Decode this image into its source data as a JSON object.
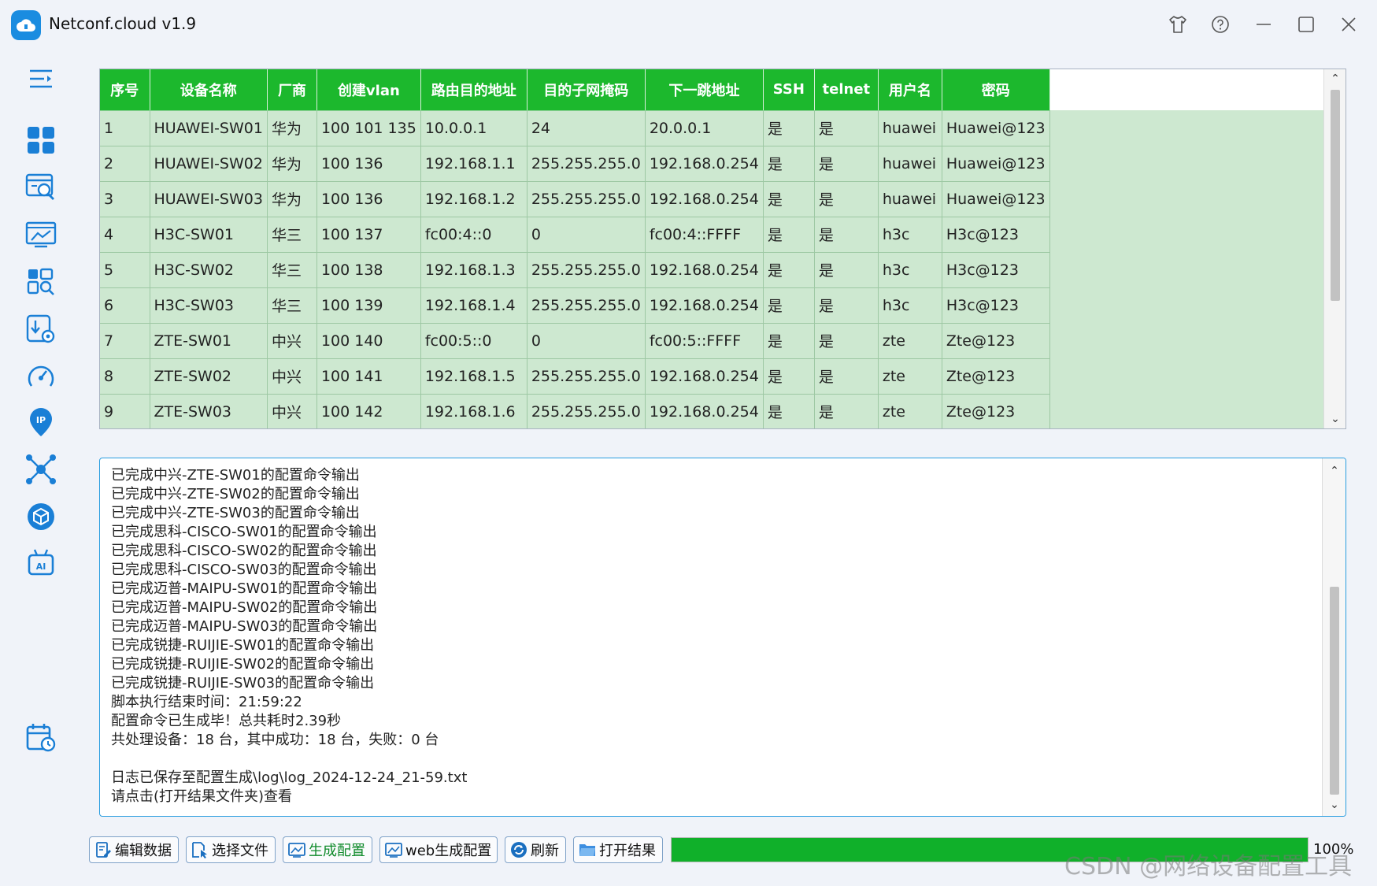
{
  "app": {
    "title": "Netconf.cloud v1.9"
  },
  "sidebar": {
    "items": [
      {
        "icon": "menu-toggle-icon"
      },
      {
        "icon": "dashboard-grid-icon"
      },
      {
        "icon": "search-screen-icon"
      },
      {
        "icon": "monitor-config-icon"
      },
      {
        "icon": "find-device-icon"
      },
      {
        "icon": "download-settings-icon"
      },
      {
        "icon": "speed-gauge-icon"
      },
      {
        "icon": "ip-location-icon"
      },
      {
        "icon": "network-topology-icon"
      },
      {
        "icon": "cube-icon"
      },
      {
        "icon": "ai-robot-icon"
      },
      {
        "icon": "calendar-clock-icon"
      }
    ]
  },
  "table": {
    "headers": [
      "序号",
      "设备名称",
      "厂商",
      "创建vlan",
      "路由目的地址",
      "目的子网掩码",
      "下一跳地址",
      "SSH",
      "telnet",
      "用户名",
      "密码"
    ],
    "rows": [
      [
        "1",
        "HUAWEI-SW01",
        "华为",
        "100 101 135",
        "10.0.0.1",
        "24",
        "20.0.0.1",
        "是",
        "是",
        "huawei",
        "Huawei@123"
      ],
      [
        "2",
        "HUAWEI-SW02",
        "华为",
        "100 136",
        "192.168.1.1",
        "255.255.255.0",
        "192.168.0.254",
        "是",
        "是",
        "huawei",
        "Huawei@123"
      ],
      [
        "3",
        "HUAWEI-SW03",
        "华为",
        "100 136",
        "192.168.1.2",
        "255.255.255.0",
        "192.168.0.254",
        "是",
        "是",
        "huawei",
        "Huawei@123"
      ],
      [
        "4",
        "H3C-SW01",
        "华三",
        "100 137",
        "fc00:4::0",
        "0",
        "fc00:4::FFFF",
        "是",
        "是",
        "h3c",
        "H3c@123"
      ],
      [
        "5",
        "H3C-SW02",
        "华三",
        "100 138",
        "192.168.1.3",
        "255.255.255.0",
        "192.168.0.254",
        "是",
        "是",
        "h3c",
        "H3c@123"
      ],
      [
        "6",
        "H3C-SW03",
        "华三",
        "100 139",
        "192.168.1.4",
        "255.255.255.0",
        "192.168.0.254",
        "是",
        "是",
        "h3c",
        "H3c@123"
      ],
      [
        "7",
        "ZTE-SW01",
        "中兴",
        "100 140",
        "fc00:5::0",
        "0",
        "fc00:5::FFFF",
        "是",
        "是",
        "zte",
        "Zte@123"
      ],
      [
        "8",
        "ZTE-SW02",
        "中兴",
        "100 141",
        "192.168.1.5",
        "255.255.255.0",
        "192.168.0.254",
        "是",
        "是",
        "zte",
        "Zte@123"
      ],
      [
        "9",
        "ZTE-SW03",
        "中兴",
        "100 142",
        "192.168.1.6",
        "255.255.255.0",
        "192.168.0.254",
        "是",
        "是",
        "zte",
        "Zte@123"
      ]
    ]
  },
  "log": {
    "lines": [
      "已完成中兴-ZTE-SW01的配置命令输出",
      "已完成中兴-ZTE-SW02的配置命令输出",
      "已完成中兴-ZTE-SW03的配置命令输出",
      "已完成思科-CISCO-SW01的配置命令输出",
      "已完成思科-CISCO-SW02的配置命令输出",
      "已完成思科-CISCO-SW03的配置命令输出",
      "已完成迈普-MAIPU-SW01的配置命令输出",
      "已完成迈普-MAIPU-SW02的配置命令输出",
      "已完成迈普-MAIPU-SW03的配置命令输出",
      "已完成锐捷-RUIJIE-SW01的配置命令输出",
      "已完成锐捷-RUIJIE-SW02的配置命令输出",
      "已完成锐捷-RUIJIE-SW03的配置命令输出",
      "脚本执行结束时间：21:59:22",
      "配置命令已生成毕！总共耗时2.39秒",
      "共处理设备：18 台，其中成功：18 台，失败：0 台",
      "",
      "日志已保存至配置生成\\log\\log_2024-12-24_21-59.txt",
      "请点击(打开结果文件夹)查看"
    ]
  },
  "toolbar": {
    "edit_label": "编辑数据",
    "select_label": "选择文件",
    "generate_label": "生成配置",
    "web_generate_label": "web生成配置",
    "refresh_label": "刷新",
    "open_label": "打开结果"
  },
  "progress": {
    "value": 1.0,
    "label": "100%"
  },
  "watermark": "CSDN @网络设备配置工具",
  "colors": {
    "header_green": "#1cb82d",
    "row_green": "#cde8d0",
    "progress_green": "#10b02a",
    "accent_blue": "#1a8ce0"
  }
}
